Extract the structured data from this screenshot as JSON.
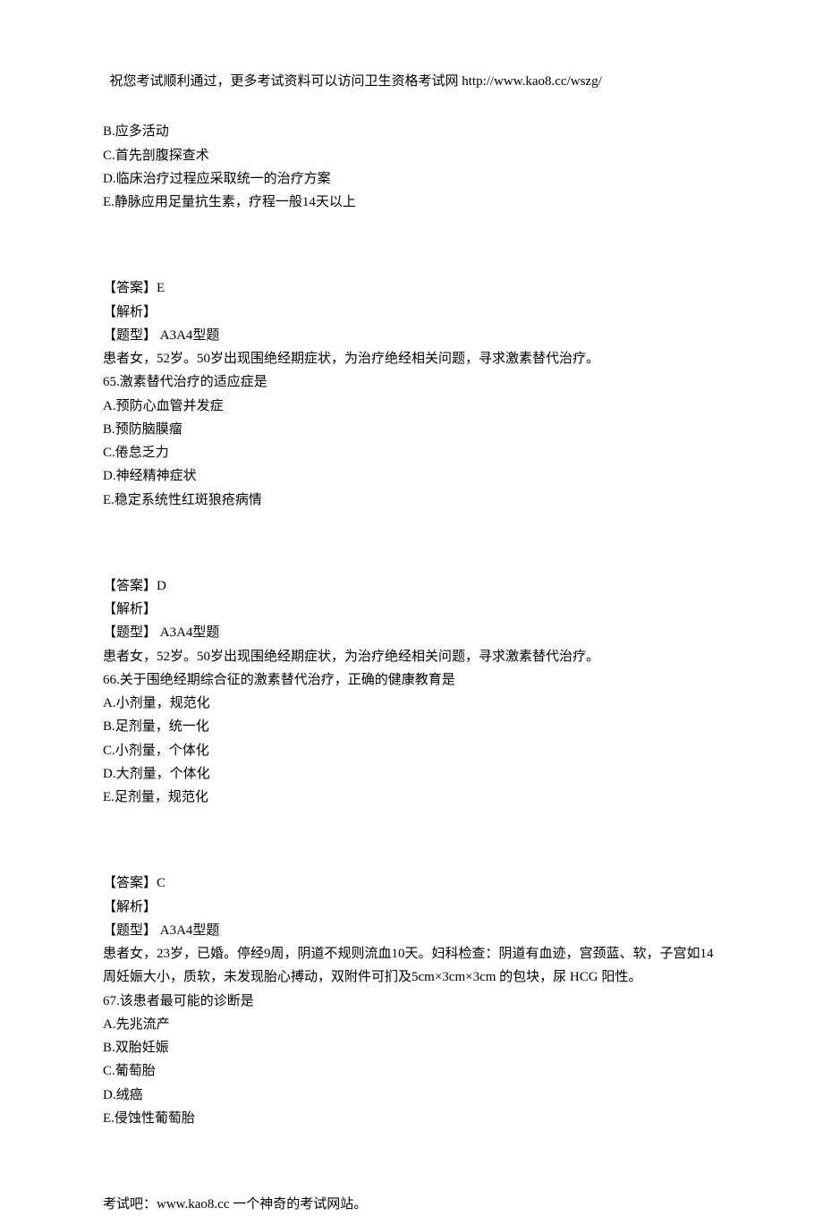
{
  "header": "祝您考试顺利通过，更多考试资料可以访问卫生资格考试网 http://www.kao8.cc/wszg/",
  "section1": {
    "options": [
      "B.应多活动",
      "C.首先剖腹探查术",
      "D.临床治疗过程应采取统一的治疗方案",
      "E.静脉应用足量抗生素，疗程一般14天以上"
    ]
  },
  "section2": {
    "answer": "【答案】E",
    "analysis": "【解析】",
    "type": "【题型】 A3A4型题",
    "context": "患者女，52岁。50岁出现围绝经期症状，为治疗绝经相关问题，寻求激素替代治疗。",
    "question": "65.激素替代治疗的适应症是",
    "options": [
      "A.预防心血管并发症",
      "B.预防脑膜瘤",
      "C.倦怠乏力",
      "D.神经精神症状",
      "E.稳定系统性红斑狼疮病情"
    ]
  },
  "section3": {
    "answer": "【答案】D",
    "analysis": "【解析】",
    "type": "【题型】 A3A4型题",
    "context": "患者女，52岁。50岁出现围绝经期症状，为治疗绝经相关问题，寻求激素替代治疗。",
    "question": "66.关于围绝经期综合征的激素替代治疗，正确的健康教育是",
    "options": [
      "A.小剂量，规范化",
      "B.足剂量，统一化",
      "C.小剂量，个体化",
      "D.大剂量，个体化",
      "E.足剂量，规范化"
    ]
  },
  "section4": {
    "answer": "【答案】C",
    "analysis": "【解析】",
    "type": "【题型】 A3A4型题",
    "context": "患者女，23岁，已婚。停经9周，阴道不规则流血10天。妇科检查：阴道有血迹，宫颈蓝、软，子宫如14周妊娠大小，质软，未发现胎心搏动，双附件可扪及5cm×3cm×3cm 的包块，尿 HCG 阳性。",
    "question": "67.该患者最可能的诊断是",
    "options": [
      "A.先兆流产",
      "B.双胎妊娠",
      "C.葡萄胎",
      "D.绒癌",
      "E.侵蚀性葡萄胎"
    ]
  },
  "footer": "考试吧：www.kao8.cc 一个神奇的考试网站。"
}
